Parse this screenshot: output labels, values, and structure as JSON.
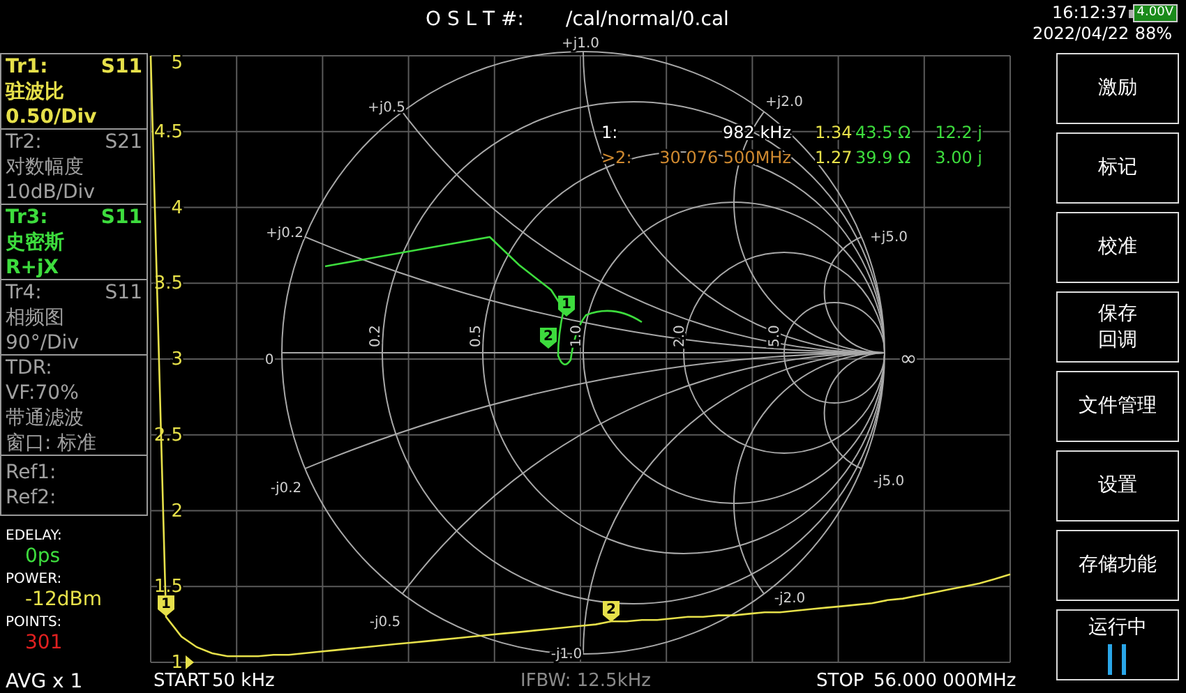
{
  "status_bar": {
    "cal_label": "O S L T #:",
    "cal_file": "/cal/normal/0.cal",
    "time": "16:12:37",
    "date": "2022/04/22",
    "battery_voltage": "4.00V",
    "battery_percent": "88%"
  },
  "traces": [
    {
      "name": "Tr1:",
      "parameter": "S11",
      "format": "驻波比",
      "scale": "0.50/Div",
      "active": true,
      "color": "#e6e04a"
    },
    {
      "name": "Tr2:",
      "parameter": "S21",
      "format": "对数幅度",
      "scale": "10dB/Div",
      "active": false
    },
    {
      "name": "Tr3:",
      "parameter": "S11",
      "format": "史密斯",
      "scale": "R+jX",
      "active": true,
      "color": "#3ddc3d"
    },
    {
      "name": "Tr4:",
      "parameter": "S11",
      "format": "相频图",
      "scale": "90°/Div",
      "active": false
    }
  ],
  "tdr": [
    "TDR:",
    "VF:70%",
    "带通滤波",
    "窗口: 标准"
  ],
  "refs": [
    "Ref1:",
    "Ref2:"
  ],
  "settings": [
    {
      "label": "EDELAY:",
      "value": "0ps",
      "color": "#3ddc3d"
    },
    {
      "label": "POWER:",
      "value": "-12dBm",
      "color": "#e6e04a"
    },
    {
      "label": "POINTS:",
      "value": "301",
      "color": "#e02020"
    }
  ],
  "average": "AVG x 1",
  "chart_data": {
    "type": "line",
    "grid": true,
    "categories": [
      null,
      null,
      null,
      null,
      null,
      null,
      null,
      null,
      null,
      null,
      null,
      null,
      null,
      null,
      null,
      null,
      null,
      null,
      null,
      null,
      null,
      null,
      null,
      null,
      null,
      null,
      null,
      null,
      null,
      null,
      null,
      null,
      null,
      null,
      null,
      null,
      null,
      null,
      null,
      null,
      null,
      null,
      null,
      null,
      null,
      null,
      null,
      null,
      null,
      null,
      null,
      null,
      null,
      null,
      null,
      null,
      null
    ],
    "ylim": [
      1,
      5
    ],
    "yticks": [
      {
        "value": 5,
        "label": "5"
      },
      {
        "value": 4.5,
        "label": "4.5"
      },
      {
        "value": 4,
        "label": "4"
      },
      {
        "value": 3.5,
        "label": "3.5"
      },
      {
        "value": 3,
        "label": "3"
      },
      {
        "value": 2.5,
        "label": "2.5"
      },
      {
        "value": 2,
        "label": "2"
      },
      {
        "value": 1.5,
        "label": "1.5"
      },
      {
        "value": 1,
        "label": "1"
      }
    ],
    "series": [
      {
        "color": "#e6e04a",
        "values": [
          5,
          1.3,
          1.17,
          1.1,
          1.06,
          1.04,
          1.04,
          1.04,
          1.05,
          1.05,
          1.06,
          1.07,
          1.08,
          1.09,
          1.1,
          1.11,
          1.12,
          1.13,
          1.14,
          1.15,
          1.16,
          1.17,
          1.18,
          1.19,
          1.2,
          1.21,
          1.22,
          1.23,
          1.24,
          1.25,
          1.27,
          1.27,
          1.28,
          1.28,
          1.29,
          1.3,
          1.3,
          1.31,
          1.31,
          1.32,
          1.33,
          1.33,
          1.34,
          1.35,
          1.36,
          1.37,
          1.38,
          1.39,
          1.41,
          1.42,
          1.44,
          1.46,
          1.48,
          1.5,
          1.52,
          1.55,
          1.58
        ]
      }
    ]
  },
  "smith_labels": [
    "+j1.0",
    "+j0.5",
    "+j2.0",
    "+j0.2",
    "+j5.0",
    "0",
    "0.2",
    "0.5",
    "1.0",
    "2.0",
    "5.0",
    "∞",
    "-j0.2",
    "-j5.0",
    "-j0.5",
    "-j2.0",
    "-j1.0"
  ],
  "markers": [
    {
      "label": "1",
      "color": "#e6e04a"
    },
    {
      "label": "2",
      "color": "#e6e04a"
    },
    {
      "label": "1",
      "color": "#3ddc3d"
    },
    {
      "label": "2",
      "color": "#3ddc3d"
    }
  ],
  "marker_readout": [
    {
      "id": "1:",
      "frequency": "982 kHz",
      "swr": "1.34",
      "resistance": "43.5 Ω",
      "reactance": "12.2 j",
      "selected": false
    },
    {
      "id": ">2:",
      "frequency": "30.076 500MHz",
      "swr": "1.27",
      "resistance": "39.9 Ω",
      "reactance": "3.00 j",
      "selected": true
    }
  ],
  "sweep": {
    "start_label": "START",
    "start": "50 kHz",
    "ifbw": "IFBW: 12.5kHz",
    "stop_label": "STOP",
    "stop": "56.000 000MHz"
  },
  "menu": [
    {
      "lines": [
        "激励"
      ],
      "kind": "menu"
    },
    {
      "lines": [
        "标记"
      ],
      "kind": "menu"
    },
    {
      "lines": [
        "校准"
      ],
      "kind": "menu"
    },
    {
      "lines": [
        "保存",
        "回调"
      ],
      "kind": "menu"
    },
    {
      "lines": [
        "文件管理"
      ],
      "kind": "menu"
    },
    {
      "lines": [
        "设置"
      ],
      "kind": "menu"
    },
    {
      "lines": [
        "存储功能"
      ],
      "kind": "menu"
    },
    {
      "lines": [
        "运行中"
      ],
      "kind": "run"
    }
  ]
}
